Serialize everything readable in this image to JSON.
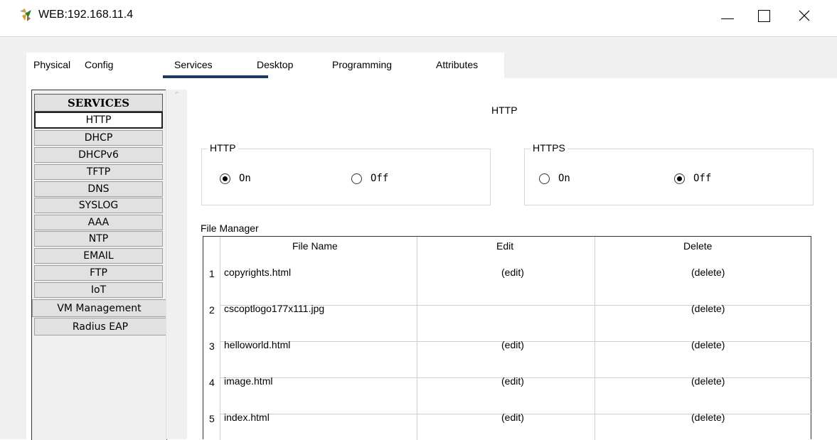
{
  "window": {
    "title": "WEB:192.168.11.4",
    "controls": {
      "minimize": "minimize-icon",
      "maximize": "maximize-icon",
      "close": "close-icon"
    }
  },
  "tabs": [
    {
      "label": "Physical"
    },
    {
      "label": "Config"
    },
    {
      "label": "Services",
      "selected": true
    },
    {
      "label": "Desktop"
    },
    {
      "label": "Programming"
    },
    {
      "label": "Attributes"
    }
  ],
  "sidebar": {
    "header": "SERVICES",
    "items": [
      {
        "label": "HTTP",
        "selected": true
      },
      {
        "label": "DHCP"
      },
      {
        "label": "DHCPv6"
      },
      {
        "label": "TFTP"
      },
      {
        "label": "DNS"
      },
      {
        "label": "SYSLOG"
      },
      {
        "label": "AAA"
      },
      {
        "label": "NTP"
      },
      {
        "label": "EMAIL"
      },
      {
        "label": "FTP"
      },
      {
        "label": "IoT"
      },
      {
        "label": "VM Management"
      },
      {
        "label": "Radius EAP"
      }
    ]
  },
  "panel": {
    "title": "HTTP",
    "http": {
      "label": "HTTP",
      "on_label": "On",
      "off_label": "Off",
      "value": "On"
    },
    "https": {
      "label": "HTTPS",
      "on_label": "On",
      "off_label": "Off",
      "value": "Off"
    },
    "file_manager": {
      "label": "File Manager",
      "columns": [
        "File Name",
        "Edit",
        "Delete"
      ],
      "rows": [
        {
          "num": "1",
          "name": "copyrights.html",
          "edit": "(edit)",
          "delete": "(delete)"
        },
        {
          "num": "2",
          "name": "cscoptlogo177x111.jpg",
          "edit": "",
          "delete": "(delete)"
        },
        {
          "num": "3",
          "name": "helloworld.html",
          "edit": "(edit)",
          "delete": "(delete)"
        },
        {
          "num": "4",
          "name": "image.html",
          "edit": "(edit)",
          "delete": "(delete)"
        },
        {
          "num": "5",
          "name": "index.html",
          "edit": "(edit)",
          "delete": "(delete)"
        }
      ]
    }
  }
}
